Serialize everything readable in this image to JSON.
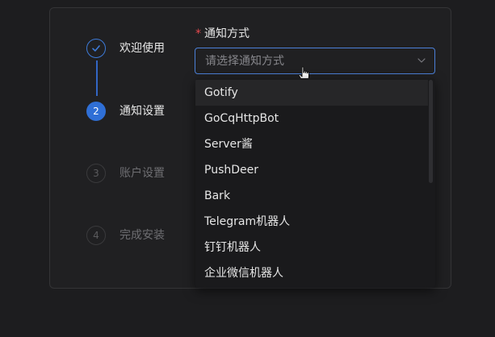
{
  "steps": [
    {
      "number": "",
      "label": "欢迎使用",
      "state": "done"
    },
    {
      "number": "2",
      "label": "通知设置",
      "state": "active"
    },
    {
      "number": "3",
      "label": "账户设置",
      "state": "pending"
    },
    {
      "number": "4",
      "label": "完成安装",
      "state": "pending"
    }
  ],
  "form": {
    "required_mark": "*",
    "label": "通知方式",
    "placeholder": "请选择通知方式"
  },
  "dropdown": {
    "options": [
      "Gotify",
      "GoCqHttpBot",
      "Server酱",
      "PushDeer",
      "Bark",
      "Telegram机器人",
      "钉钉机器人",
      "企业微信机器人"
    ],
    "hovered_index": 0
  },
  "icons": {
    "step1": "check-icon",
    "select": "chevron-down-icon",
    "cursor": "hand-pointer-icon"
  },
  "colors": {
    "accent": "#2f6fd6",
    "required": "#e5484d"
  }
}
